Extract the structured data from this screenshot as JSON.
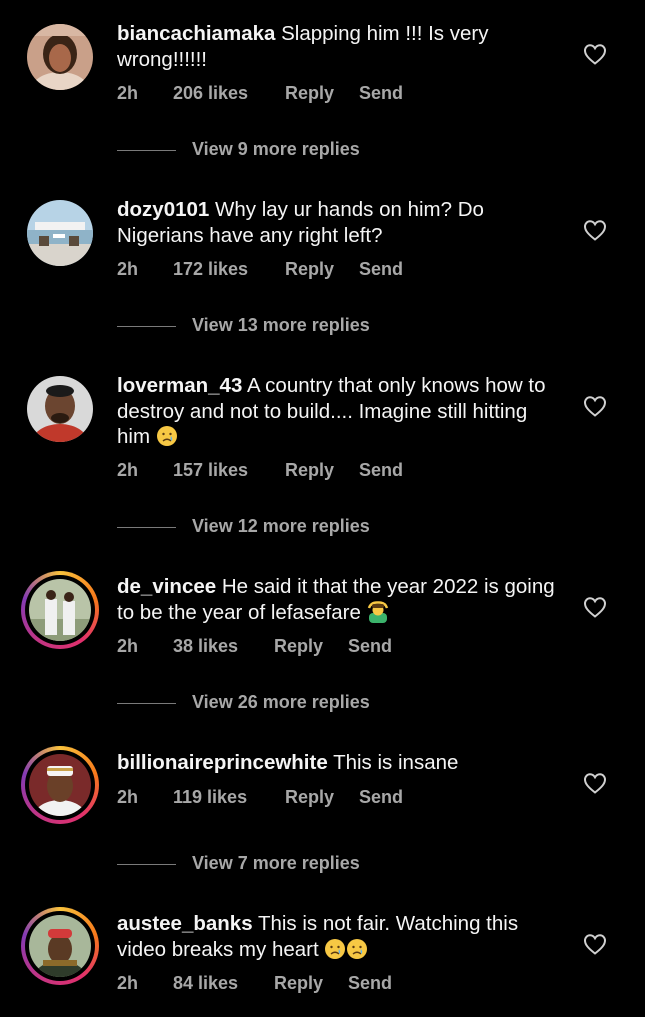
{
  "colors": {
    "background": "#000000",
    "text": "#f5f5f5",
    "muted": "#a8a8a8",
    "story_ring": "#e1306c"
  },
  "comments": [
    {
      "username": "biancachiamaka",
      "text": "Slapping him !!! Is very wrong!!!!!!",
      "emoji": "",
      "time": "2h",
      "likes": "206 likes",
      "reply": "Reply",
      "send": "Send",
      "view_replies": "View 9 more replies",
      "avatar_icon": "avatar-photo",
      "has_story": false
    },
    {
      "username": "dozy0101",
      "text": "Why lay ur hands on him? Do Nigerians have any right left?",
      "emoji": "",
      "time": "2h",
      "likes": "172 likes",
      "reply": "Reply",
      "send": "Send",
      "view_replies": "View 13 more replies",
      "avatar_icon": "avatar-photo",
      "has_story": false
    },
    {
      "username": "loverman_43",
      "text": "A country that only knows how to destroy and not to build.... Imagine still hitting him",
      "emoji": "😢",
      "time": "2h",
      "likes": "157 likes",
      "reply": "Reply",
      "send": "Send",
      "view_replies": "View 12 more replies",
      "avatar_icon": "avatar-photo",
      "has_story": false
    },
    {
      "username": "de_vincee",
      "text": "He said it that the year 2022 is going to be the year of lefasefare",
      "emoji": "🙆",
      "time": "2h",
      "likes": "38 likes",
      "reply": "Reply",
      "send": "Send",
      "view_replies": "View 26 more replies",
      "avatar_icon": "avatar-photo",
      "has_story": true
    },
    {
      "username": "billionaireprincewhite",
      "text": "This is insane",
      "emoji": "",
      "time": "2h",
      "likes": "119 likes",
      "reply": "Reply",
      "send": "Send",
      "view_replies": "View 7 more replies",
      "avatar_icon": "avatar-photo",
      "has_story": true
    },
    {
      "username": "austee_banks",
      "text": "This is not fair. Watching this video breaks my heart",
      "emoji": "😢😢",
      "time": "2h",
      "likes": "84 likes",
      "reply": "Reply",
      "send": "Send",
      "view_replies": "",
      "avatar_icon": "avatar-photo",
      "has_story": true
    }
  ]
}
